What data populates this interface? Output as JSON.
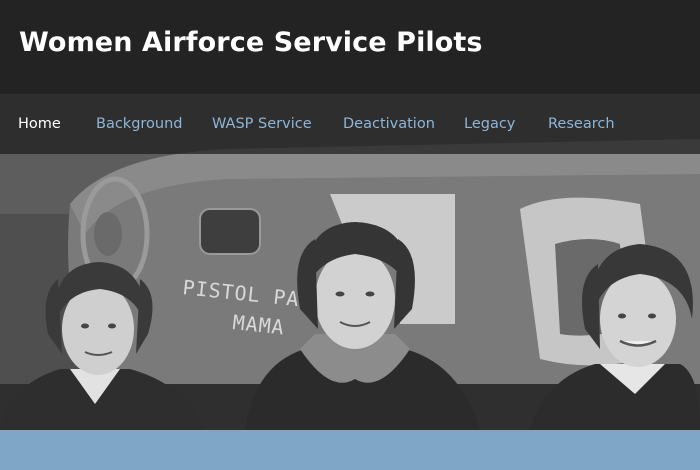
{
  "site": {
    "title": "Women Airforce Service Pilots"
  },
  "nav": {
    "items": [
      {
        "label": "Home",
        "active": true
      },
      {
        "label": "Background",
        "active": false
      },
      {
        "label": "WASP Service",
        "active": false
      },
      {
        "label": "Deactivation",
        "active": false
      },
      {
        "label": "Legacy",
        "active": false
      },
      {
        "label": "Research",
        "active": false
      }
    ]
  },
  "hero": {
    "plane_nose_text_line1": "PISTOL PACKIN'",
    "plane_nose_text_line2": "MAMA"
  },
  "colors": {
    "header_bg": "#232323",
    "nav_link": "#8fb6d8",
    "nav_active": "#ffffff",
    "accent_band": "#7fa6c6"
  }
}
